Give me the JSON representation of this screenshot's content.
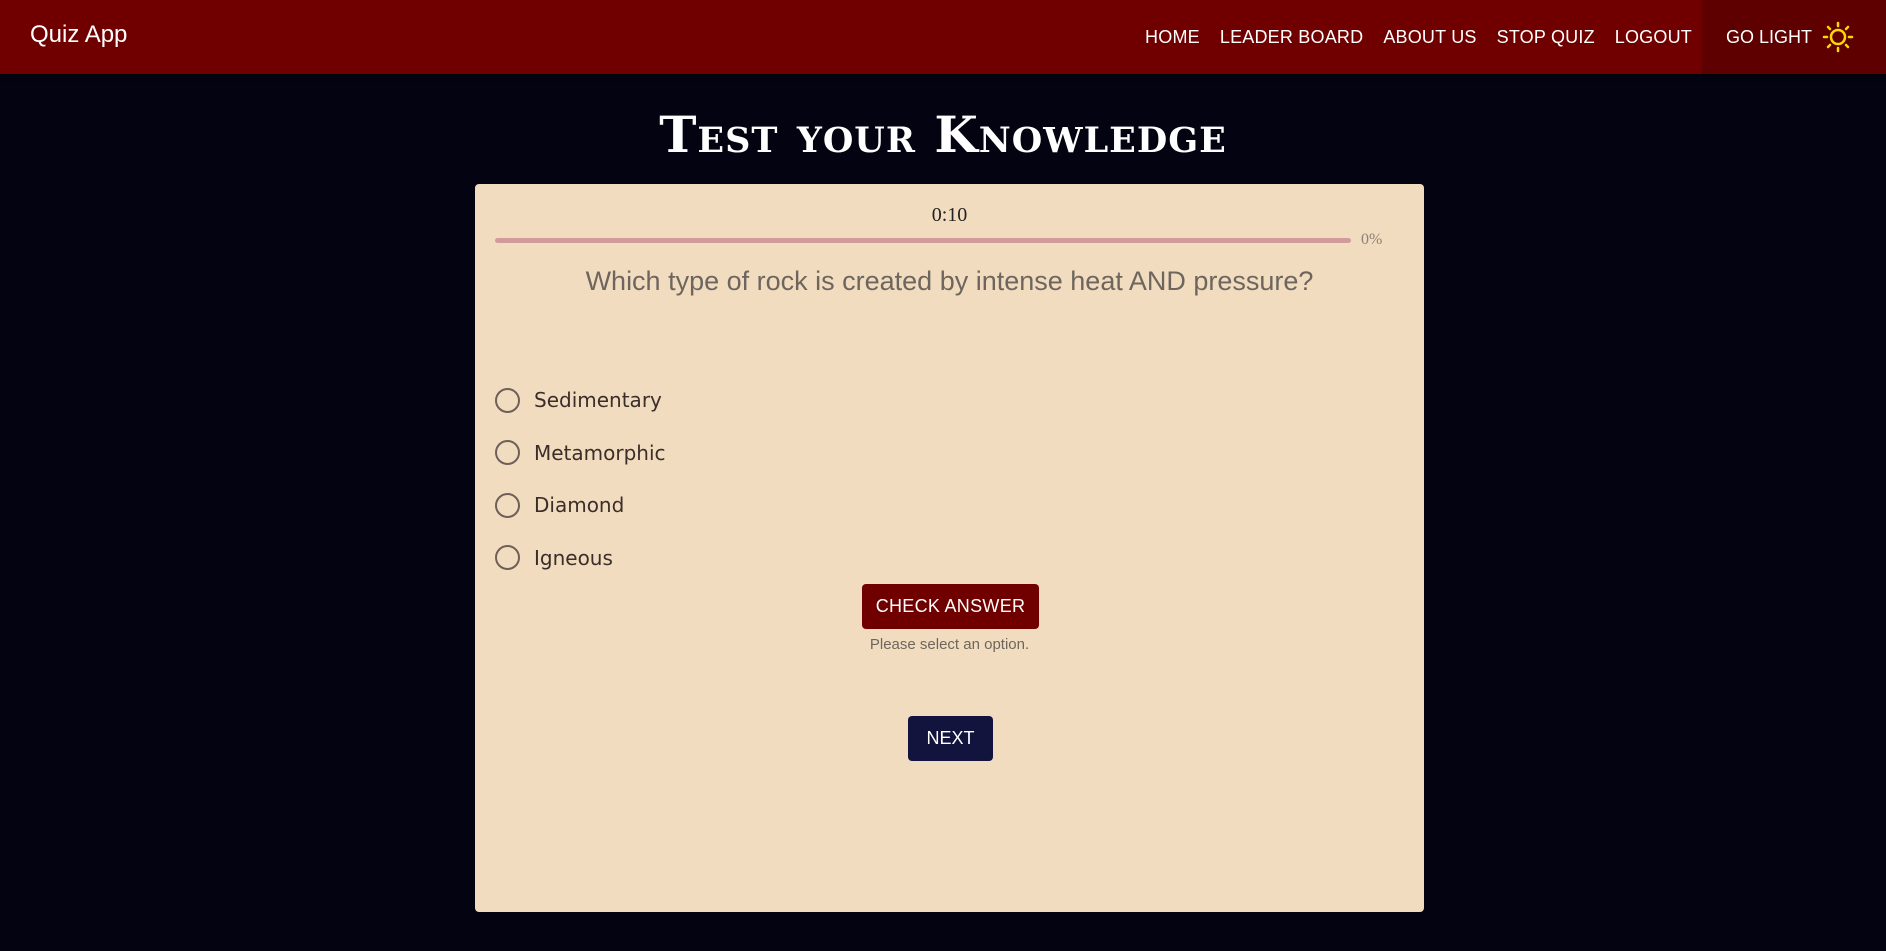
{
  "navbar": {
    "brand": "Quiz App",
    "links": [
      "HOME",
      "LEADER BOARD",
      "ABOUT US",
      "STOP QUIZ",
      "LOGOUT"
    ],
    "theme_toggle_label": "GO LIGHT",
    "theme_icon": "sun-icon"
  },
  "page": {
    "title": "Test your Knowledge"
  },
  "quiz": {
    "timer": "0:10",
    "progress_label": "0%",
    "progress_value": 0,
    "question": "Which type of rock is created by intense heat AND pressure?",
    "options": [
      "Sedimentary",
      "Metamorphic",
      "Diamond",
      "Igneous"
    ],
    "selected_option": null,
    "check_button_label": "CHECK ANSWER",
    "hint": "Please select an option.",
    "next_button_label": "NEXT"
  },
  "colors": {
    "navbar": "#700000",
    "background": "#030312",
    "card": "#f2dcbf",
    "check_button": "#700000",
    "next_button": "#12143d",
    "sun": "#ffd700"
  }
}
